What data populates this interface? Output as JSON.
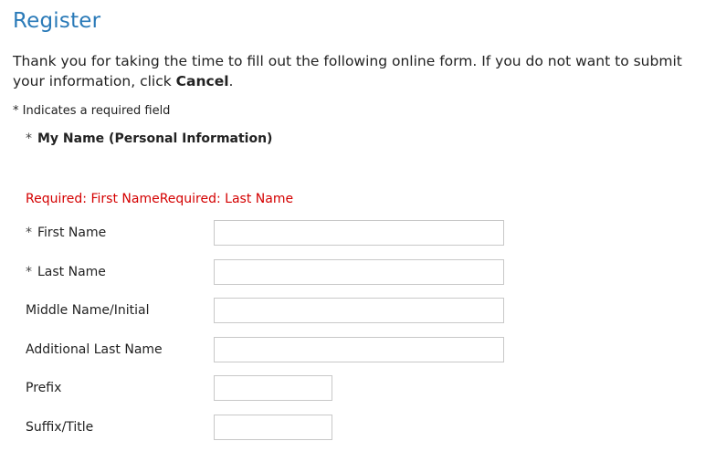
{
  "page": {
    "title": "Register",
    "intro_text": "Thank you for taking the time to fill out the following online form. If you do not want to submit your information, click ",
    "intro_cancel": "Cancel",
    "intro_end": ".",
    "required_note": "* Indicates a required field"
  },
  "section": {
    "star": "*",
    "label": "My Name (Personal Information)"
  },
  "errors": {
    "text": "Required: First NameRequired: Last Name",
    "color": "#d40000"
  },
  "fields": {
    "first_name": {
      "star": "*",
      "label": "First Name",
      "value": ""
    },
    "last_name": {
      "star": "*",
      "label": "Last Name",
      "value": ""
    },
    "middle_name": {
      "label": "Middle Name/Initial",
      "value": ""
    },
    "additional_last_name": {
      "label": "Additional Last Name",
      "value": ""
    },
    "prefix": {
      "label": "Prefix",
      "value": ""
    },
    "suffix": {
      "label": "Suffix/Title",
      "value": ""
    }
  },
  "colors": {
    "title": "#2a7ab8",
    "error": "#d40000",
    "input_border": "#c8c8c8"
  }
}
